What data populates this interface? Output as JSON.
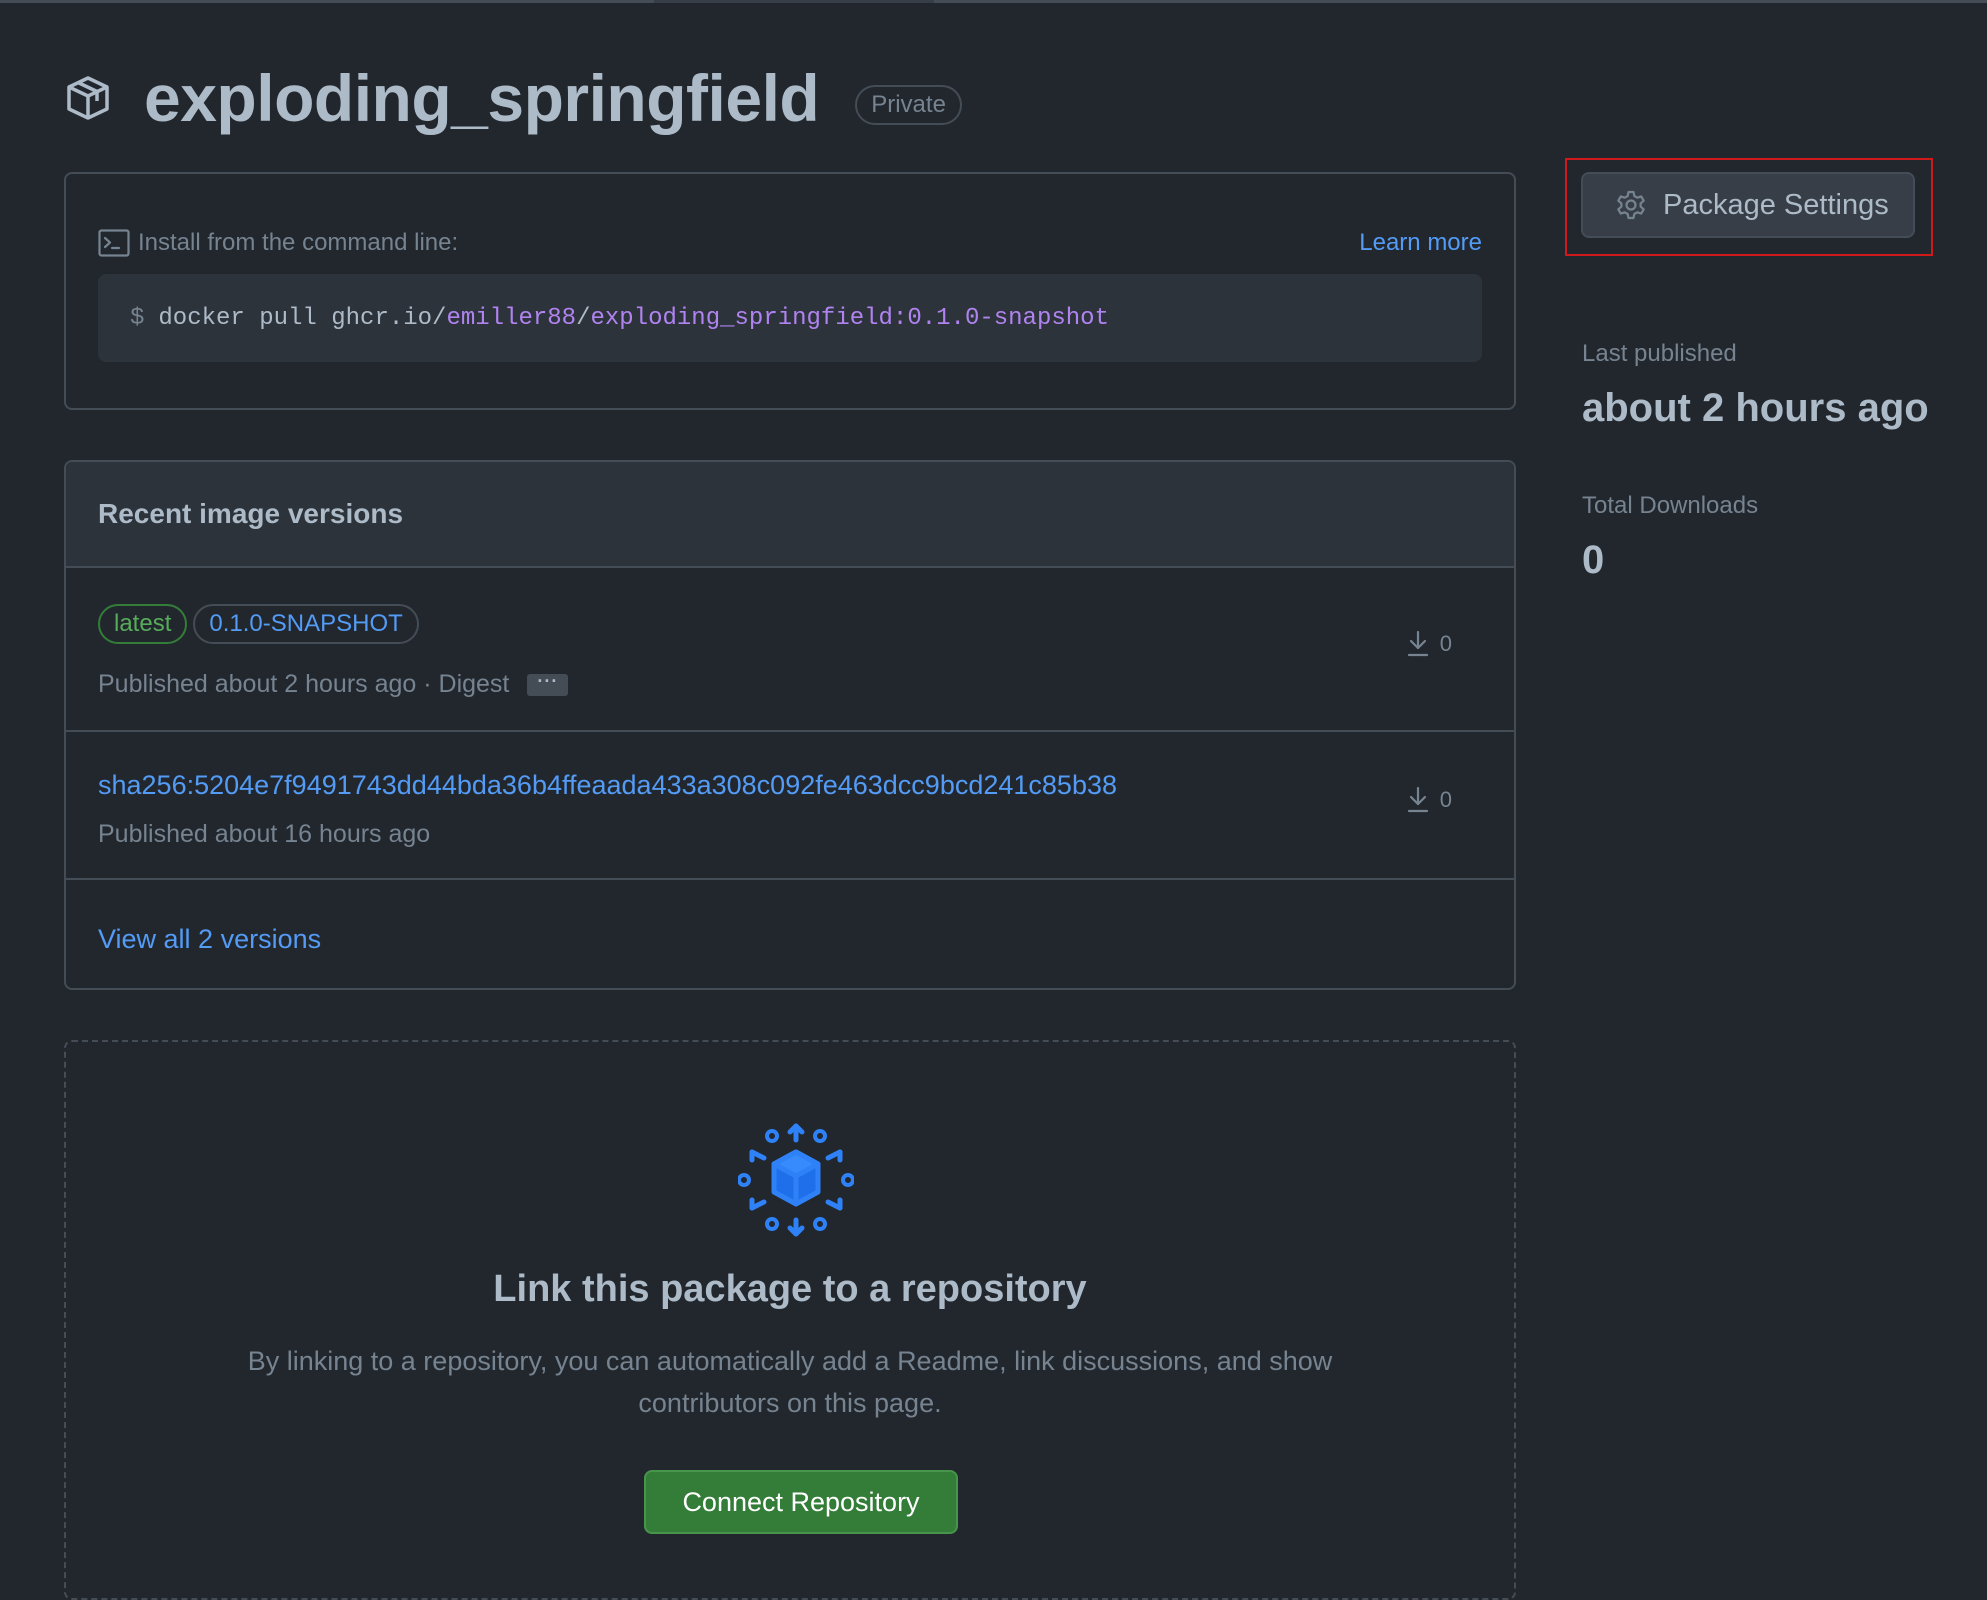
{
  "package": {
    "name": "exploding_springfield",
    "visibility": "Private"
  },
  "install": {
    "label": "Install from the command line:",
    "learn_more": "Learn more",
    "prompt": "$",
    "command_prefix": "docker pull ghcr.io/",
    "command_owner": "emiller88",
    "command_sep": "/",
    "command_image": "exploding_springfield:0.1.0-snapshot"
  },
  "versions": {
    "heading": "Recent image versions",
    "items": [
      {
        "tags": [
          "latest",
          "0.1.0-SNAPSHOT"
        ],
        "published": "Published about 2 hours ago · Digest",
        "digest_button": "···",
        "downloads": "0"
      },
      {
        "digest": "sha256:5204e7f9491743dd44bda36b4ffeaada433a308c092fe463dcc9bcd241c85b38",
        "published": "Published about 16 hours ago",
        "downloads": "0"
      }
    ],
    "view_all": "View all 2 versions"
  },
  "link_repo": {
    "title": "Link this package to a repository",
    "description": "By linking to a repository, you can automatically add a Readme, link discussions, and show contributors on this page.",
    "button": "Connect Repository"
  },
  "sidebar": {
    "settings_button": "Package Settings",
    "last_published_label": "Last published",
    "last_published_value": "about 2 hours ago",
    "total_downloads_label": "Total Downloads",
    "total_downloads_value": "0"
  },
  "colors": {
    "background": "#22272e",
    "link": "#539bf5",
    "success": "#347d39",
    "highlight": "#d0191b"
  }
}
